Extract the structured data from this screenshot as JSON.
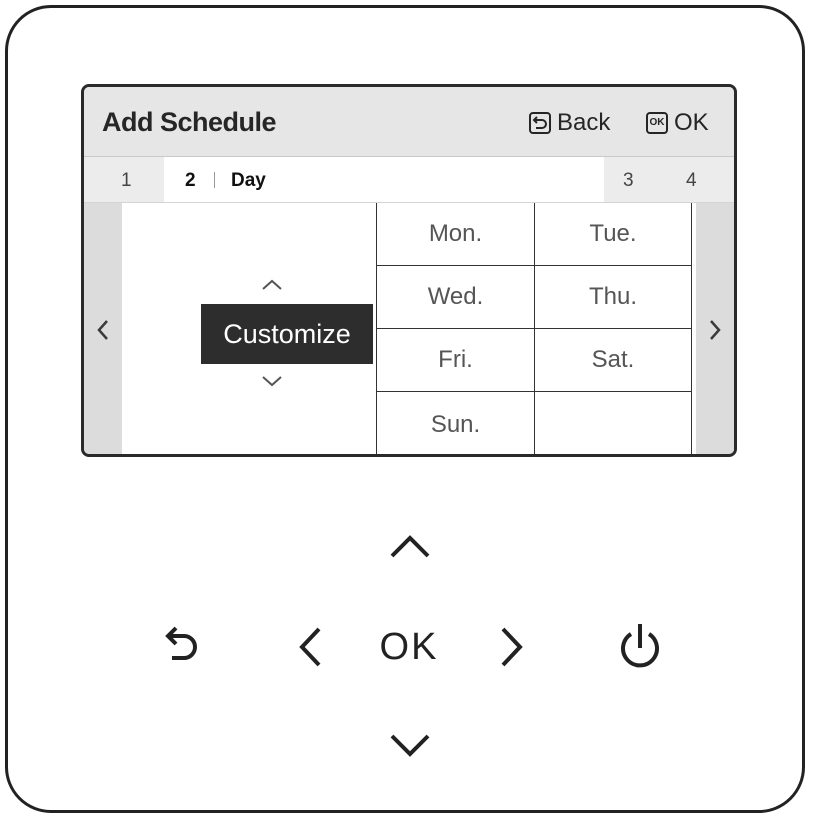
{
  "screen": {
    "title": "Add Schedule",
    "back_label": "Back",
    "ok_label": "OK",
    "ok_icon_text": "OK",
    "steps": [
      {
        "number": "1"
      },
      {
        "number": "2",
        "label": "Day",
        "active": true
      },
      {
        "number": "3"
      },
      {
        "number": "4"
      }
    ],
    "selector": {
      "value": "Customize"
    },
    "days": [
      "Mon.",
      "Tue.",
      "Wed.",
      "Thu.",
      "Fri.",
      "Sat.",
      "Sun.",
      ""
    ]
  },
  "keypad": {
    "ok_label": "OK",
    "icons": [
      "up-icon",
      "down-icon",
      "left-icon",
      "right-icon",
      "back-icon",
      "power-icon"
    ]
  }
}
